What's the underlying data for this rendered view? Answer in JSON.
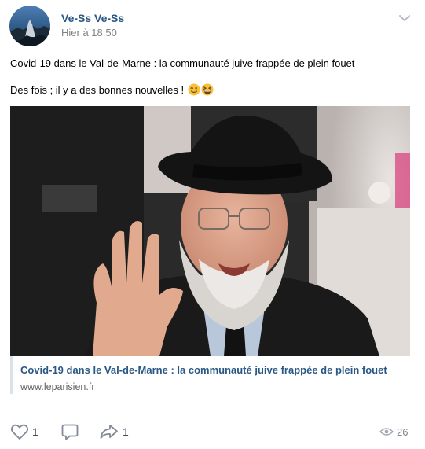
{
  "post": {
    "author_name": "Ve-Ss Ve-Ss",
    "timestamp": "Hier à 18:50",
    "text_line1": "Covid-19 dans le Val-de-Marne : la communauté juive frappée de plein fouet",
    "text_line2": "Des fois ; il y a des bonnes nouvelles !",
    "emojis": [
      "winking-face-emoji",
      "grinning-squinting-face-emoji"
    ]
  },
  "link_preview": {
    "title": "Covid-19 dans le Val-de-Marne : la communauté juive frappée de plein fouet",
    "domain": "www.leparisien.fr"
  },
  "actions": {
    "likes_count": "1",
    "shares_count": "1",
    "views_count": "26"
  },
  "colors": {
    "link_blue": "#2a5885",
    "meta_gray": "#828282",
    "icon_gray": "#828a99",
    "divider": "#e7e8ec"
  }
}
